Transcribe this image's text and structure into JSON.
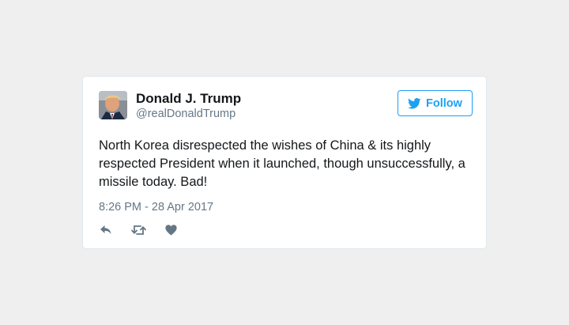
{
  "tweet": {
    "author": {
      "display_name": "Donald J. Trump",
      "handle": "@realDonaldTrump",
      "avatar_icon": "profile-photo"
    },
    "follow_button": {
      "label": "Follow",
      "icon": "twitter-bird-icon",
      "color": "#1da1f2"
    },
    "text": "North Korea disrespected the wishes of China & its highly respected President when it launched, though unsuccessfully, a missile today. Bad!",
    "timestamp": "8:26 PM - 28 Apr 2017",
    "actions": [
      {
        "name": "reply",
        "icon": "reply-icon"
      },
      {
        "name": "retweet",
        "icon": "retweet-icon"
      },
      {
        "name": "like",
        "icon": "heart-icon"
      }
    ]
  },
  "colors": {
    "background": "#efefef",
    "card": "#ffffff",
    "accent": "#1da1f2",
    "muted": "#657786",
    "icon": "#657786"
  }
}
